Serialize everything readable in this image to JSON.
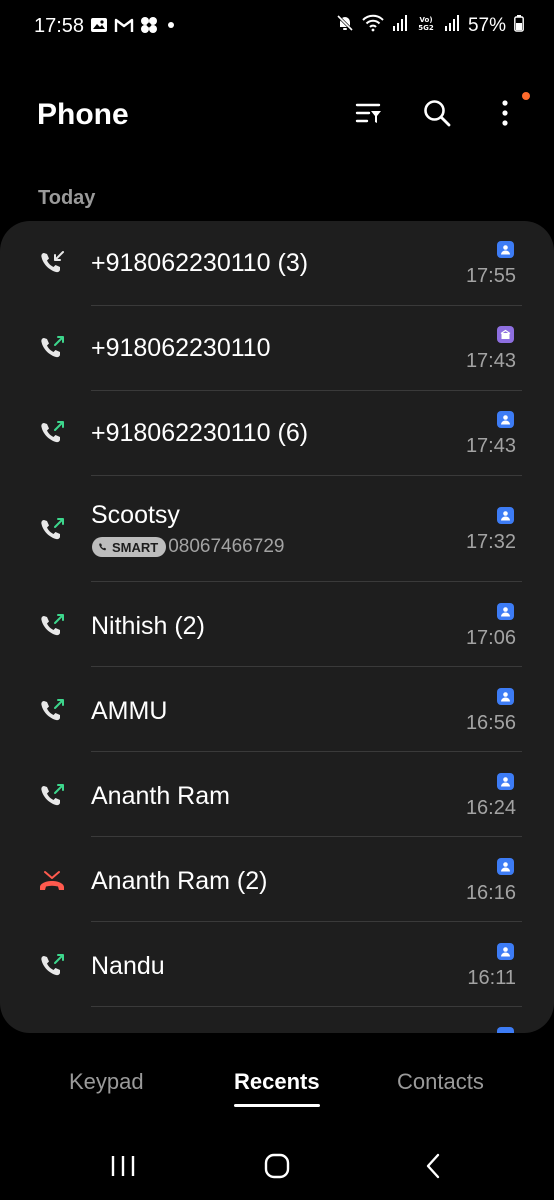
{
  "status_bar": {
    "time": "17:58",
    "battery": "57%",
    "left_icons": [
      "gallery-icon",
      "gmail-icon",
      "pinwheel-icon",
      "dot-icon"
    ],
    "right_icons": [
      "mute-icon",
      "wifi-icon",
      "signal-icon",
      "volte-icon",
      "signal-icon",
      "battery-icon"
    ]
  },
  "app_bar": {
    "title": "Phone",
    "actions": [
      "filter-icon",
      "search-icon",
      "more-icon"
    ]
  },
  "section": {
    "label": "Today"
  },
  "calls": [
    {
      "name": "+918062230110 (3)",
      "time": "17:55",
      "type": "incoming",
      "badge": "contact"
    },
    {
      "name": "+918062230110",
      "time": "17:43",
      "type": "outgoing",
      "badge": "business"
    },
    {
      "name": "+918062230110 (6)",
      "time": "17:43",
      "type": "outgoing",
      "badge": "contact"
    },
    {
      "name": "Scootsy",
      "time": "17:32",
      "type": "outgoing",
      "badge": "contact",
      "smart_label": "SMART",
      "smart_number": "08067466729"
    },
    {
      "name": "Nithish (2)",
      "time": "17:06",
      "type": "outgoing",
      "badge": "contact"
    },
    {
      "name": "AMMU",
      "time": "16:56",
      "type": "outgoing",
      "badge": "contact"
    },
    {
      "name": "Ananth Ram",
      "time": "16:24",
      "type": "outgoing",
      "badge": "contact"
    },
    {
      "name": "Ananth Ram (2)",
      "time": "16:16",
      "type": "missed",
      "badge": "contact"
    },
    {
      "name": "Nandu",
      "time": "16:11",
      "type": "outgoing",
      "badge": "contact"
    }
  ],
  "tabs": [
    {
      "label": "Keypad",
      "active": false
    },
    {
      "label": "Recents",
      "active": true
    },
    {
      "label": "Contacts",
      "active": false
    }
  ],
  "colors": {
    "outgoing_arrow": "#3dd68c",
    "missed": "#ff5a4e",
    "contact_badge": "#3d7cf5",
    "business_badge": "#8e6fe0",
    "notification_dot": "#ff6a2c"
  }
}
